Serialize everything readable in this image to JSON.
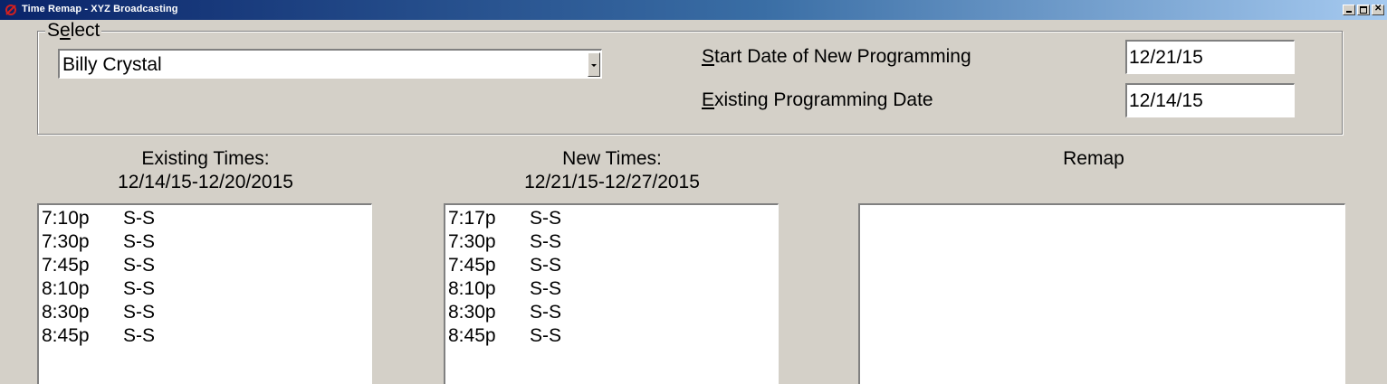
{
  "window": {
    "title": "Time Remap - XYZ Broadcasting"
  },
  "select": {
    "legend_pre": "S",
    "legend_hot": "e",
    "legend_post": "lect",
    "combo_value": "Billy Crystal"
  },
  "fields": {
    "start_date_hot": "S",
    "start_date_rest": "tart Date of New Programming",
    "start_date_value": "12/21/15",
    "existing_date_hot": "E",
    "existing_date_rest": "xisting Programming Date",
    "existing_date_value": "12/14/15"
  },
  "existing": {
    "heading_line1": "Existing Times:",
    "heading_line2": "12/14/15-12/20/2015",
    "rows": [
      {
        "time": "7:10p",
        "days": "S-S"
      },
      {
        "time": "7:30p",
        "days": "S-S"
      },
      {
        "time": "7:45p",
        "days": "S-S"
      },
      {
        "time": "8:10p",
        "days": "S-S"
      },
      {
        "time": "8:30p",
        "days": "S-S"
      },
      {
        "time": "8:45p",
        "days": "S-S"
      }
    ]
  },
  "new": {
    "heading_line1": "New Times:",
    "heading_line2": "12/21/15-12/27/2015",
    "rows": [
      {
        "time": "7:17p",
        "days": "S-S"
      },
      {
        "time": "7:30p",
        "days": "S-S"
      },
      {
        "time": "7:45p",
        "days": "S-S"
      },
      {
        "time": "8:10p",
        "days": "S-S"
      },
      {
        "time": "8:30p",
        "days": "S-S"
      },
      {
        "time": "8:45p",
        "days": "S-S"
      }
    ]
  },
  "remap": {
    "heading": "Remap",
    "rows": []
  }
}
